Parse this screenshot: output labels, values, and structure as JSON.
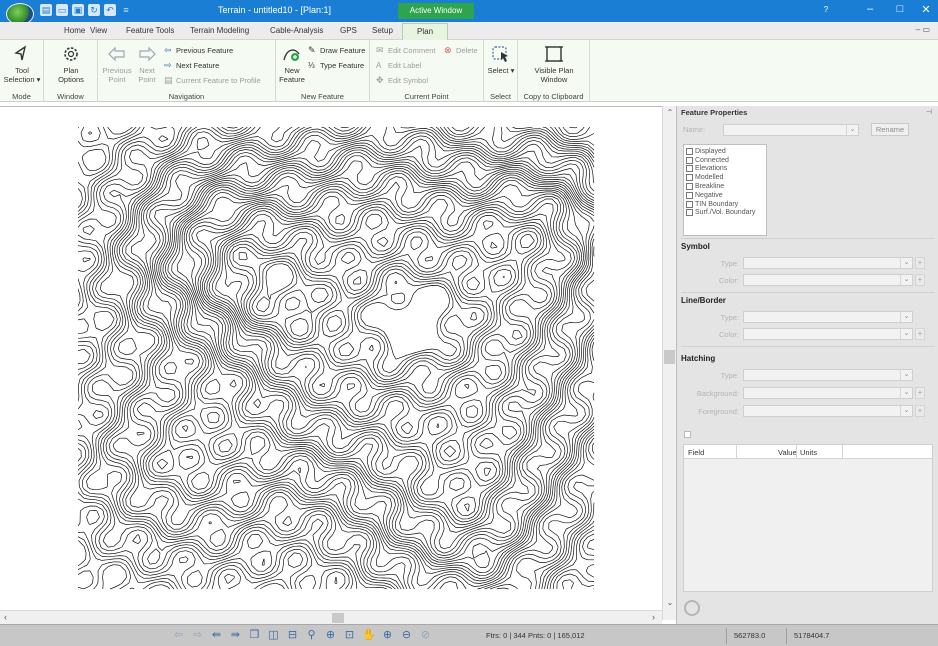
{
  "titlebar": {
    "title": "Terrain - untitled10 - [Plan:1]",
    "active_window_label": "Active Window",
    "minimize": "–",
    "maximize": "□",
    "close": "✕",
    "help": "?"
  },
  "tabs": [
    "Home",
    "View",
    "Feature Tools",
    "Terrain Modeling",
    "Cable-Analysis",
    "GPS",
    "Setup",
    "Plan"
  ],
  "active_tab": "Plan",
  "ribbon": {
    "mode": {
      "label": "Mode",
      "tool_selection": "Tool Selection ▾"
    },
    "window": {
      "label": "Window",
      "plan_options": "Plan Options"
    },
    "navigation": {
      "label": "Navigation",
      "previous_point": "Previous Point",
      "next_point": "Next Point",
      "previous_feature": "Previous Feature",
      "next_feature": "Next Feature",
      "current_feature_to_profile": "Current Feature to Profile"
    },
    "new_feature": {
      "label": "New Feature",
      "new_feature": "New Feature",
      "draw_feature": "Draw Feature",
      "type_feature": "Type Feature"
    },
    "current_point": {
      "label": "Current Point",
      "edit_comment": "Edit Comment",
      "delete": "Delete",
      "edit_label": "Edit Label",
      "edit_symbol": "Edit Symbol"
    },
    "select": {
      "label": "Select",
      "select": "Select ▾"
    },
    "clipboard": {
      "label": "Copy to Clipboard",
      "visible_plan_window": "Visible Plan Window"
    }
  },
  "panel": {
    "title": "Feature Properties",
    "name_label": "Name:",
    "rename": "Rename",
    "checklist": [
      "Displayed",
      "Connected",
      "Elevations",
      "Modelled",
      "Breakline",
      "Negative",
      "TIN Boundary",
      "Surf./Vol. Boundary"
    ],
    "symbol": {
      "header": "Symbol",
      "type_label": "Type:",
      "color_label": "Color:"
    },
    "line_border": {
      "header": "Line/Border",
      "type_label": "Type:",
      "color_label": "Color:"
    },
    "hatching": {
      "header": "Hatching",
      "type_label": "Type:",
      "background_label": "Background:",
      "foreground_label": "Foreground:"
    },
    "grid_headers": {
      "field": "Field",
      "value": "Value",
      "units": "Units"
    }
  },
  "statusbar": {
    "feature_info": "Ftrs: 0 | 344  Pnts: 0 | 165,012",
    "x_coord": "562783.0",
    "y_coord": "5178404.7"
  },
  "icons": {
    "previous_point": "arrow-left-icon",
    "next_point": "arrow-right-icon",
    "gear": "gear-icon",
    "pan": "hand-icon",
    "zoom_in": "zoom-in-icon",
    "zoom_out": "zoom-out-icon"
  }
}
